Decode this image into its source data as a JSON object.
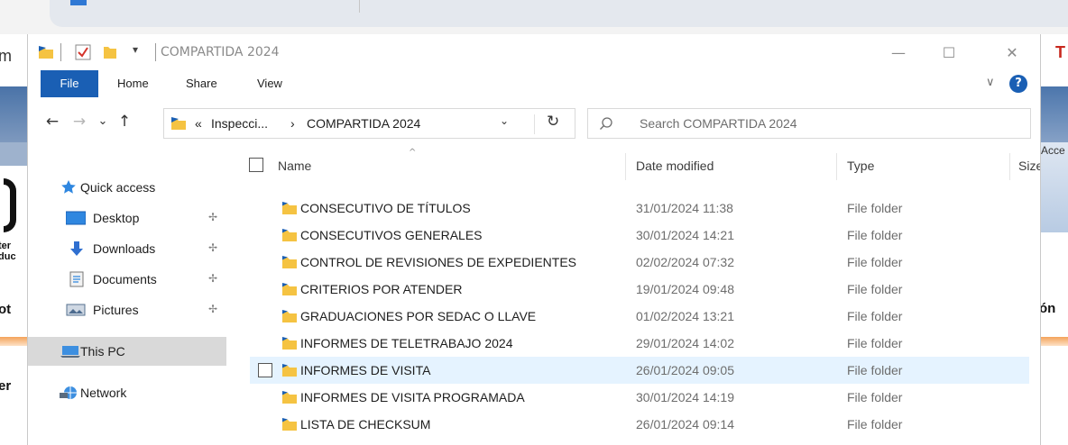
{
  "background": {
    "left_fragments": [
      "m",
      "ter",
      "duc",
      "ot",
      "er"
    ],
    "right_fragments": [
      "T",
      "Acce",
      "ón"
    ]
  },
  "window": {
    "title": "COMPARTIDA 2024",
    "minimize_glyph": "—",
    "maximize_glyph": "☐",
    "close_glyph": "✕",
    "dropdown_glyph": "▾"
  },
  "ribbon": {
    "tabs": [
      "File",
      "Home",
      "Share",
      "View"
    ],
    "expand_glyph": "∨",
    "help_glyph": "?"
  },
  "navigation": {
    "back_glyph": "←",
    "forward_glyph": "→",
    "recent_glyph": "⌄",
    "up_glyph": "↑",
    "address": {
      "overflow": "«",
      "parent": "Inspecci...",
      "separator": "›",
      "current": "COMPARTIDA 2024",
      "dropdown_glyph": "⌄",
      "refresh_glyph": "↻"
    },
    "search": {
      "placeholder": "Search COMPARTIDA 2024"
    }
  },
  "sidebar": {
    "items": [
      {
        "label": "Quick access",
        "icon": "star-icon",
        "pinned": false
      },
      {
        "label": "Desktop",
        "icon": "desktop-icon",
        "pinned": true
      },
      {
        "label": "Downloads",
        "icon": "download-icon",
        "pinned": true
      },
      {
        "label": "Documents",
        "icon": "document-icon",
        "pinned": true
      },
      {
        "label": "Pictures",
        "icon": "pictures-icon",
        "pinned": true
      },
      {
        "label": "This PC",
        "icon": "computer-icon",
        "pinned": false
      },
      {
        "label": "Network",
        "icon": "network-icon",
        "pinned": false
      }
    ],
    "pin_glyph": "✢"
  },
  "file_list": {
    "columns": [
      "Name",
      "Date modified",
      "Type",
      "Size"
    ],
    "sort_glyph": "^",
    "rows": [
      {
        "name": "CONSECUTIVO DE TÍTULOS",
        "date": "31/01/2024 11:38",
        "type": "File folder"
      },
      {
        "name": "CONSECUTIVOS GENERALES",
        "date": "30/01/2024 14:21",
        "type": "File folder"
      },
      {
        "name": "CONTROL DE REVISIONES DE EXPEDIENTES",
        "date": "02/02/2024 07:32",
        "type": "File folder"
      },
      {
        "name": "CRITERIOS POR ATENDER",
        "date": "19/01/2024 09:48",
        "type": "File folder"
      },
      {
        "name": "GRADUACIONES POR SEDAC O LLAVE",
        "date": "01/02/2024 13:21",
        "type": "File folder"
      },
      {
        "name": "INFORMES DE TELETRABAJO 2024",
        "date": "29/01/2024 14:02",
        "type": "File folder"
      },
      {
        "name": "INFORMES DE VISITA",
        "date": "26/01/2024 09:05",
        "type": "File folder"
      },
      {
        "name": "INFORMES DE VISITA PROGRAMADA",
        "date": "30/01/2024 14:19",
        "type": "File folder"
      },
      {
        "name": "LISTA DE CHECKSUM",
        "date": "26/01/2024 09:14",
        "type": "File folder"
      }
    ],
    "hovered_row": "INFORMES DE VISITA"
  },
  "colors": {
    "accent": "#1a5fb4",
    "folder": "#f5c342",
    "hover_row": "#e5f3ff",
    "selected_nav": "#d9d9d9"
  }
}
